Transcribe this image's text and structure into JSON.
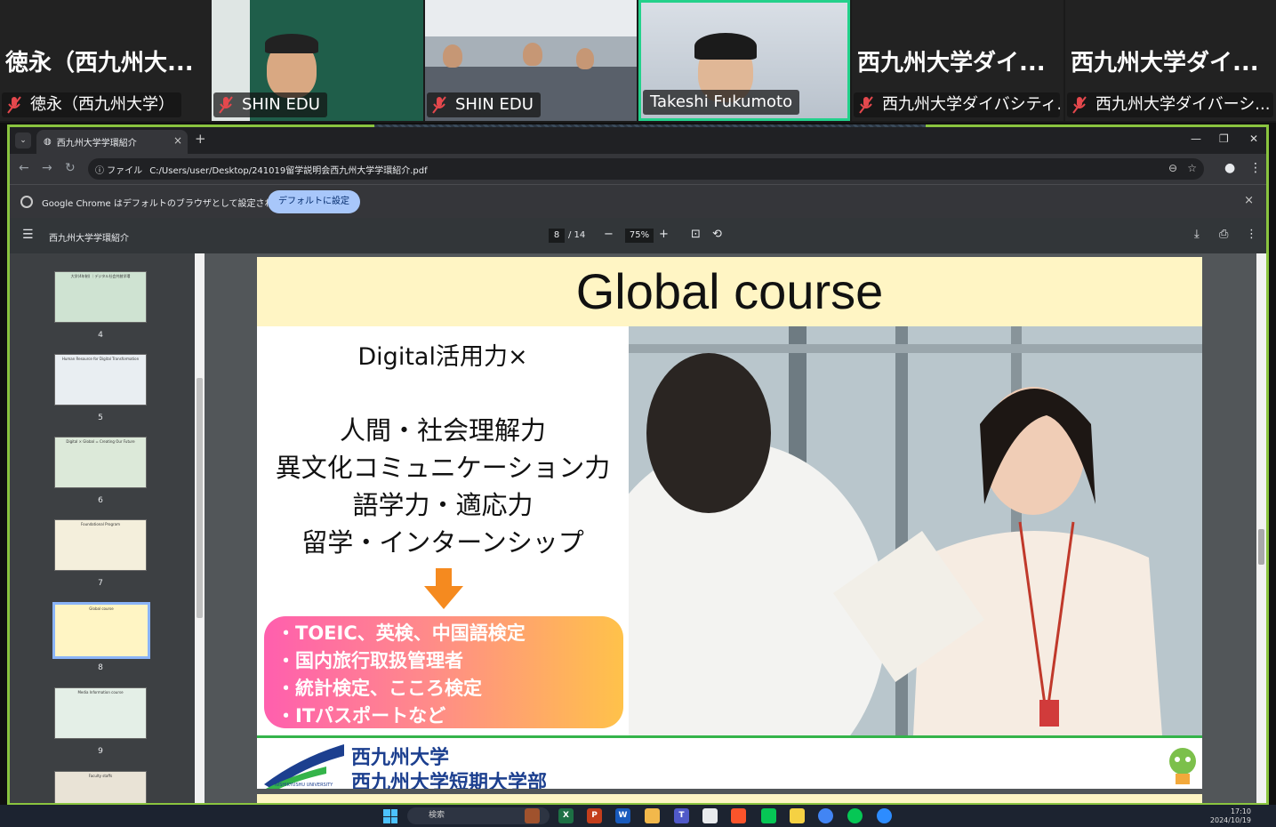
{
  "participants": [
    {
      "display": "徳永（西九州大...",
      "label": "徳永（西九州大学）",
      "muted": true
    },
    {
      "label": "SHIN EDU",
      "muted": true
    },
    {
      "label": "SHIN EDU",
      "muted": true
    },
    {
      "label": "Takeshi Fukumoto",
      "muted": false,
      "active": true
    },
    {
      "display": "西九州大学ダイ...",
      "label": "西九州大学ダイバシティ...",
      "muted": true
    },
    {
      "display": "西九州大学ダイ...",
      "label": "西九州大学ダイバーシ...",
      "muted": true
    }
  ],
  "browser": {
    "tab_title": "西九州大学学環紹介",
    "tab_close": "×",
    "new_tab": "+",
    "address_chip": "ⓘ ファイル",
    "url": "C:/Users/user/Desktop/241019留学説明会西九州大学学環紹介.pdf",
    "infobar_message": "Google Chrome はデフォルトのブラウザとして設定されていません",
    "infobar_button": "デフォルトに設定",
    "infobar_close": "×"
  },
  "pdf": {
    "doc_title": "西九州大学学環紹介",
    "current_page": "8",
    "total_pages": "/ 14",
    "zoom": "75%",
    "zoom_out": "−",
    "zoom_in": "+"
  },
  "thumbnails": [
    {
      "num": "4",
      "title": "大学(4年制) ｜デジタル社会共創学環"
    },
    {
      "num": "5",
      "title": "Human Resource for Digital Transformation"
    },
    {
      "num": "6",
      "title": "Digital × Global = Creating Our Future"
    },
    {
      "num": "7",
      "title": "Foundational Program"
    },
    {
      "num": "8",
      "title": "Global course",
      "selected": true
    },
    {
      "num": "9",
      "title": "Media Information course"
    },
    {
      "num": "",
      "title": "Faculty staffs"
    }
  ],
  "slide": {
    "title": "Global course",
    "line1": "Digital活用力×",
    "line2": "人間・社会理解力",
    "line3": "異文化コミュニケーション力",
    "line4": "語学力・適応力",
    "line5": "留学・インターンシップ",
    "items": [
      "・TOEIC、英検、中国語検定",
      "・国内旅行取扱管理者",
      "・統計検定、こころ検定",
      "・ITパスポートなど"
    ],
    "footer_line1": "西九州大学",
    "footer_line2": "西九州大学短期大学部",
    "footer_en": "NISHIKYUSHU UNIVERSITY"
  },
  "taskbar": {
    "search_placeholder": "検索",
    "time": "17:10",
    "date": "2024/10/19"
  },
  "colors": {
    "active_speaker": "#23d18b",
    "share_border": "#8ac43f",
    "slide_header": "#fff5c4",
    "university_blue": "#1c3f8f"
  }
}
